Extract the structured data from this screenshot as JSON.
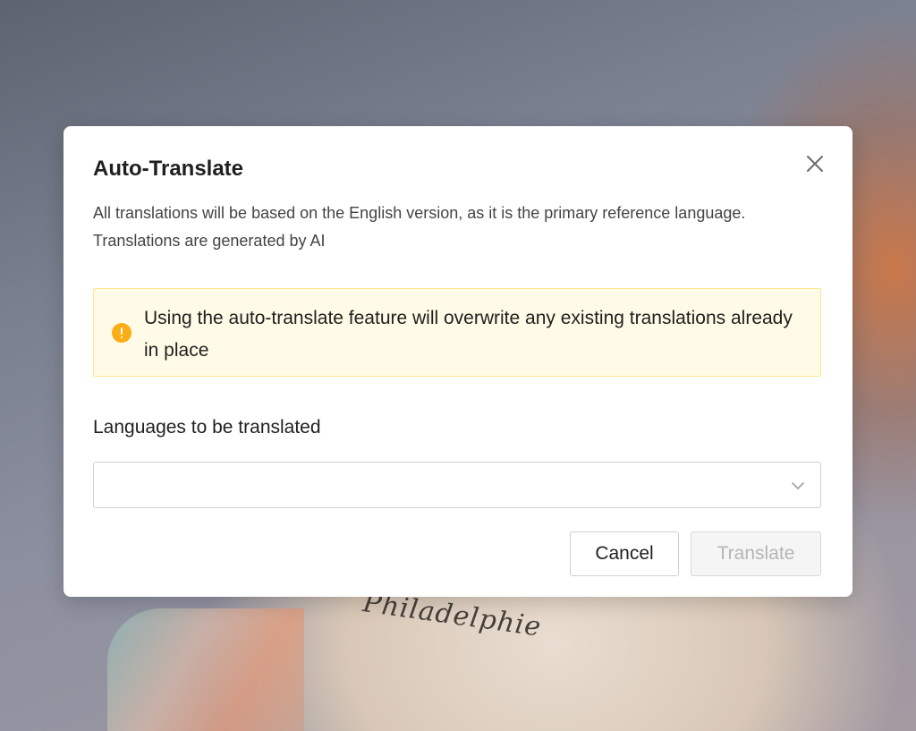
{
  "background": {
    "map_label": "Philadelphie"
  },
  "dialog": {
    "title": "Auto-Translate",
    "description_line1": "All translations will be based on the English version, as it is the primary reference language.",
    "description_line2": "Translations are generated by AI",
    "warning": {
      "icon": "exclamation-circle-icon",
      "color": "#faad14",
      "text": "Using the auto-translate feature will overwrite any existing translations already in place"
    },
    "languages_field": {
      "label": "Languages to be translated",
      "value": ""
    },
    "cancel_label": "Cancel",
    "translate_label": "Translate",
    "translate_disabled": true
  }
}
